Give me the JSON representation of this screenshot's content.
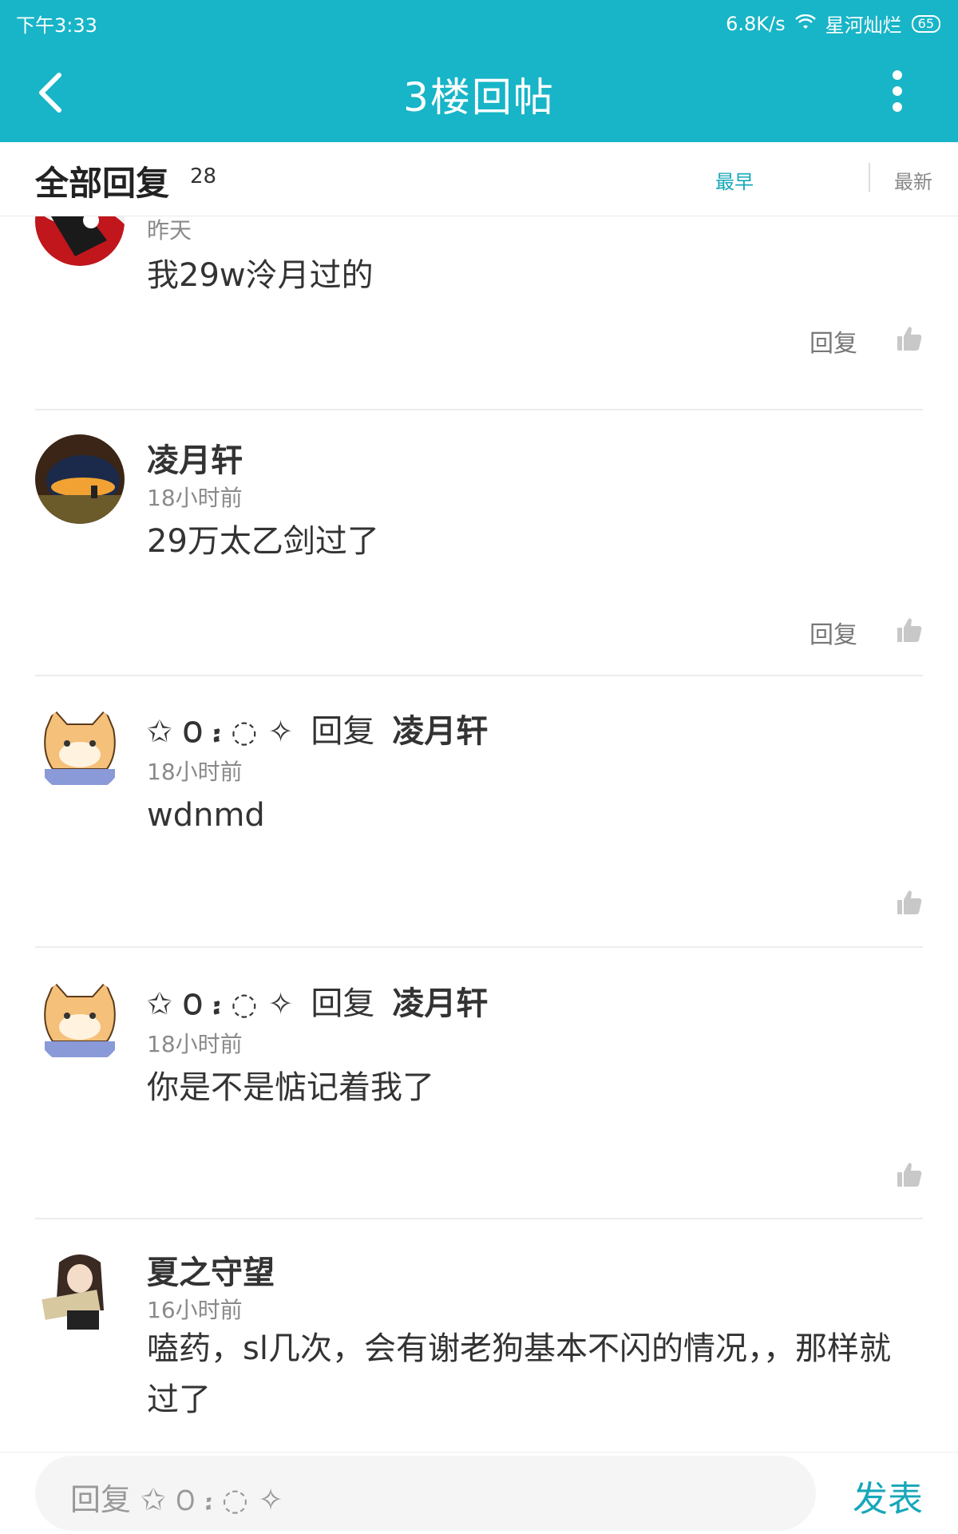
{
  "status": {
    "time": "下午3:33",
    "speed": "6.8K/s",
    "network": "星河灿烂",
    "battery": "65"
  },
  "header": {
    "title": "3楼回帖"
  },
  "filter": {
    "label": "全部回复",
    "count": "28",
    "sort_early": "最早",
    "sort_new": "最新"
  },
  "posts": [
    {
      "author": "",
      "time": "昨天",
      "text": "我29w泠月过的",
      "reply_label": "回复"
    },
    {
      "author": "凌月轩",
      "time": "18小时前",
      "text": "29万太乙剑过了",
      "reply_label": "回复"
    },
    {
      "author_decor": "✩ ꯰ ᎓ ◌ ✧",
      "reply_word": "回复",
      "reply_target": "凌月轩",
      "time": "18小时前",
      "text": "wdnmd"
    },
    {
      "author_decor": "✩ ꯰ ᎓ ◌ ✧",
      "reply_word": "回复",
      "reply_target": "凌月轩",
      "time": "18小时前",
      "text": "你是不是惦记着我了"
    },
    {
      "author": "夏之守望",
      "time": "16小时前",
      "text": "嗑药，sl几次，会有谢老狗基本不闪的情况，，那样就过了"
    }
  ],
  "composer": {
    "placeholder_prefix": "回复",
    "placeholder_decor": "✩ ꯰ ᎓ ◌ ✧",
    "send_label": "发表"
  },
  "colors": {
    "accent": "#17b5c7",
    "link": "#17a7ba"
  },
  "icons": [
    "back-icon",
    "more-icon",
    "wifi-icon",
    "thumbs-up-icon"
  ]
}
